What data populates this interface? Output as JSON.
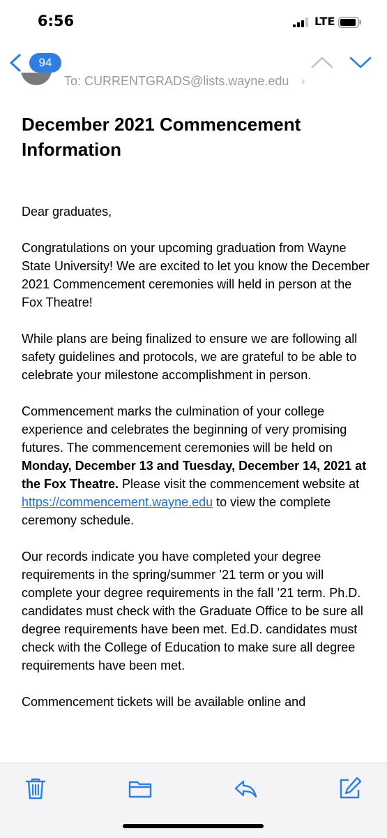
{
  "status_bar": {
    "time": "6:56",
    "network": "LTE"
  },
  "nav": {
    "unread_count": "94"
  },
  "recipient": {
    "text": "To: CURRENTGRADS@lists.wayne.edu"
  },
  "email": {
    "subject": "December 2021 Commencement Information",
    "greeting": "Dear graduates,",
    "p1": "Congratulations on your upcoming graduation from Wayne State University! We are excited to let you know the December 2021 Commencement ceremonies will held in person at the Fox Theatre!",
    "p2": "While plans are being finalized to ensure we are following all safety guidelines and protocols, we are grateful to be able to celebrate your milestone accomplishment in person.",
    "p3_a": "Commencement marks the culmination of your college experience and celebrates the beginning of very promising futures. The commencement ceremonies will be held on ",
    "p3_bold": "Monday, December 13 and Tuesday, December 14, 2021 at the Fox Theatre.",
    "p3_b": " Please visit the commencement website at ",
    "p3_link": "https://commencement.wayne.edu",
    "p3_c": " to view the complete ceremony schedule.",
    "p4": "Our records indicate you have completed your degree requirements in the spring/summer ’21 term or you will complete your degree requirements in the fall ’21 term. Ph.D. candidates must check with the Graduate Office to be sure all degree requirements have been met. Ed.D. candidates must check with the College of Education to make sure all degree requirements have been met.",
    "p5": "Commencement tickets will be available online and"
  },
  "colors": {
    "accent": "#2f7fe0",
    "link": "#1f6fd6",
    "toolbar_bg": "#f4f4f6"
  },
  "icons": {
    "back": "chevron-left-icon",
    "up": "chevron-up-icon",
    "down": "chevron-down-icon",
    "trash": "trash-icon",
    "folder": "folder-icon",
    "reply": "reply-icon",
    "compose": "compose-icon"
  }
}
